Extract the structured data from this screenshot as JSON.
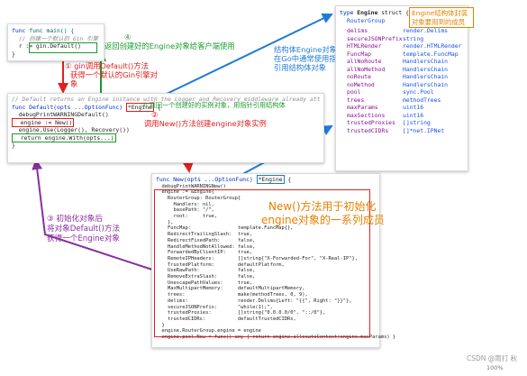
{
  "panel_main": {
    "lines": [
      "func main() {",
      "  // 创建一个默认的 Gin 引擎",
      "  r := gin.Default()",
      "}"
    ]
  },
  "panel_default": {
    "comment": "// Default returns an Engine instance with the Logger and Recovery middleware already attached.",
    "sig_a": "func Default(opts ...OptionFunc) ",
    "sig_b": "*Engine",
    "sig_c": " {",
    "body": [
      "  debugPrintWARNINGDefault()",
      "  engine := New()",
      "  engine.Use(Logger(), Recovery())",
      "  return engine.With(opts...)",
      "}"
    ]
  },
  "panel_struct": {
    "header_kw": "type ",
    "header_name": "Engine",
    "header_tail": " struct {",
    "embedded": "RouterGroup",
    "fields": [
      {
        "name": "delims",
        "type": "render.Delims"
      },
      {
        "name": "secureJSONPrefix",
        "type": "string"
      },
      {
        "name": "HTMLRender",
        "type": "render.HTMLRender"
      },
      {
        "name": "FuncMap",
        "type": "template.FuncMap"
      },
      {
        "name": "allNoRoute",
        "type": "HandlersChain"
      },
      {
        "name": "allNoMethod",
        "type": "HandlersChain"
      },
      {
        "name": "noRoute",
        "type": "HandlersChain"
      },
      {
        "name": "noMethod",
        "type": "HandlersChain"
      },
      {
        "name": "pool",
        "type": "sync.Pool"
      },
      {
        "name": "trees",
        "type": "methodTrees"
      },
      {
        "name": "maxParams",
        "type": "uint16"
      },
      {
        "name": "maxSections",
        "type": "uint16"
      },
      {
        "name": "trustedProxies",
        "type": "[]string"
      },
      {
        "name": "trustedCIDRs",
        "type": "[]*net.IPNet"
      }
    ],
    "note_lines": [
      "Engine结构体封装",
      "对象要用到的成员"
    ]
  },
  "panel_new": {
    "sig_a": "func New(opts ...OptionFunc) ",
    "sig_b": "*Engine",
    "sig_c": " {",
    "lines": [
      "  debugPrintWARNINGNew()",
      "  engine := &Engine{",
      "    RouterGroup: RouterGroup{",
      "      Handlers: nil,",
      "      basePath: \"/\",",
      "      root:     true,",
      "    },",
      "    FuncMap:                template.FuncMap{},",
      "    RedirectTrailingSlash:  true,",
      "    RedirectFixedPath:      false,",
      "    HandleMethodNotAllowed: false,",
      "    ForwardedByClientIP:    true,",
      "    RemoteIPHeaders:        []string{\"X-Forwarded-For\", \"X-Real-IP\"},",
      "    TrustedPlatform:        defaultPlatform,",
      "    UseRawPath:             false,",
      "    RemoveExtraSlash:       false,",
      "    UnescapePathValues:     true,",
      "    MaxMultipartMemory:     defaultMultipartMemory,",
      "    trees:                  make(methodTrees, 0, 9),",
      "    delims:                 render.Delims{Left: \"{{\", Right: \"}}\"},",
      "    secureJSONPrefix:       \"while(1);\",",
      "    trustedProxies:         []string{\"0.0.0.0/0\", \"::/0\"},",
      "    trustedCIDRs:           defaultTrustedCIDRs,",
      "  }",
      "  engine.RouterGroup.engine = engine",
      "  engine.pool.New = func() any { return engine.allocateContext(engine.maxParams) }"
    ]
  },
  "annotations": {
    "n1_lines": [
      "① gin调用Default()方法",
      "获得一个默认的Gin引擎对象"
    ],
    "n2_lines": [
      "② 返回一个创建好的实例对象，用指针引用结构体"
    ],
    "n2b_lines": [
      "②",
      "调用New()方法创建engine对象实例"
    ],
    "n3_lines": [
      "③ 初始化对象后",
      "将对象Default()方法",
      "获得一个Engine对象"
    ],
    "n4_lines": [
      "④",
      "返回创建好的Engine对象给客户端使用"
    ],
    "struct_ref_lines": [
      "结构体Engine对象",
      "在Go中通常使用指针",
      "引用结构体对象"
    ],
    "new_desc_lines": [
      "New()方法用于初始化",
      "engine对象的一系列成员"
    ]
  },
  "watermark": "CSDN @雨打 秋",
  "zoom": "100%",
  "colors": {
    "red": "#e02020",
    "green": "#1a9a2c",
    "blue": "#1e7bd6",
    "purple": "#8a2ea0",
    "orange": "#e68000"
  }
}
